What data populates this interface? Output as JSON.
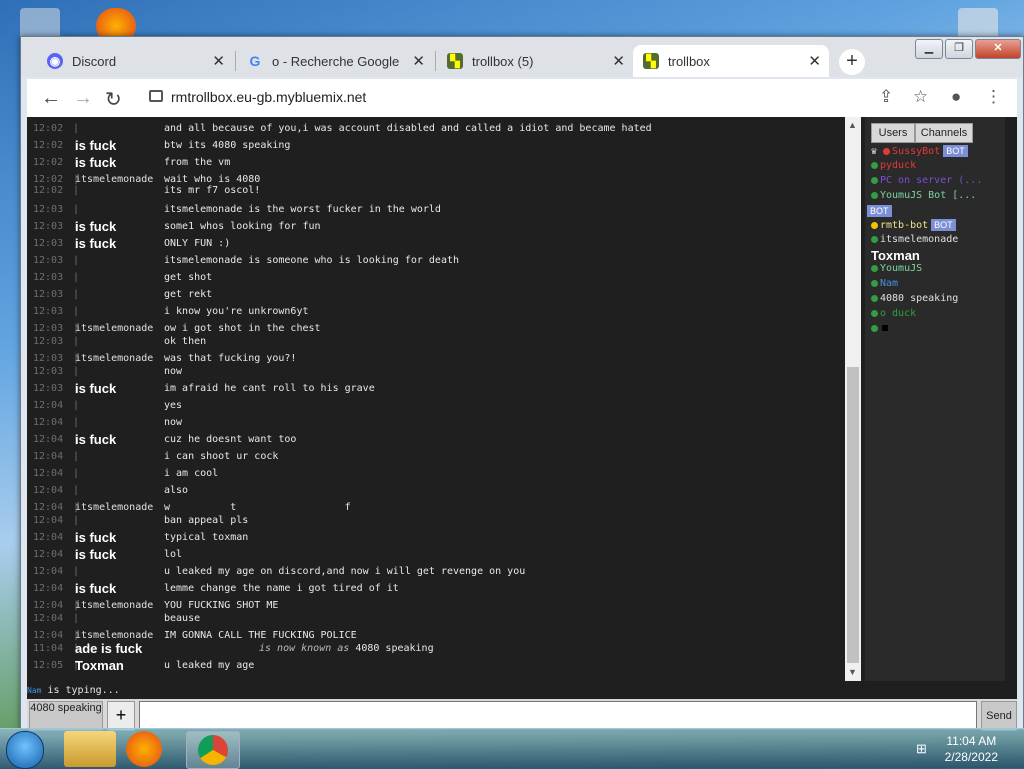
{
  "browser": {
    "tabs": [
      {
        "label": "Discord",
        "icon": "discord-icon"
      },
      {
        "label": "o - Recherche Google",
        "icon": "google-icon"
      },
      {
        "label": "trollbox (5)",
        "icon": "trollbox-icon"
      },
      {
        "label": "trollbox",
        "icon": "trollbox-icon"
      }
    ],
    "url": "rmtrollbox.eu-gb.mybluemix.net"
  },
  "messages": [
    {
      "time": "12:02",
      "user": "",
      "bold": false,
      "text": "and all because of you,i was account disabled and called a idiot and became hated"
    },
    {
      "time": "12:02",
      "user": "is fuck",
      "bold": true,
      "text": "btw its 4080 speaking"
    },
    {
      "time": "12:02",
      "user": "is fuck",
      "bold": true,
      "text": "from the vm"
    },
    {
      "time": "12:02",
      "user": "itsmelemonade",
      "bold": false,
      "text": "wait who is 4080"
    },
    {
      "time": "12:02",
      "user": "",
      "bold": false,
      "text": "its mr f7 oscol!"
    },
    {
      "time": "12:03",
      "user": "",
      "bold": false,
      "text": "itsmelemonade is the worst fucker in the world"
    },
    {
      "time": "12:03",
      "user": "is fuck",
      "bold": true,
      "text": "some1 whos looking for fun"
    },
    {
      "time": "12:03",
      "user": "is fuck",
      "bold": true,
      "text": "ONLY FUN :)"
    },
    {
      "time": "12:03",
      "user": "",
      "bold": false,
      "text": "itsmelemonade is someone who is looking for death"
    },
    {
      "time": "12:03",
      "user": "",
      "bold": false,
      "text": "get shot"
    },
    {
      "time": "12:03",
      "user": "",
      "bold": false,
      "text": "get rekt"
    },
    {
      "time": "12:03",
      "user": "",
      "bold": false,
      "text": "i know you're unkrown6yt"
    },
    {
      "time": "12:03",
      "user": "itsmelemonade",
      "bold": false,
      "text": "ow i got shot in the chest"
    },
    {
      "time": "12:03",
      "user": "",
      "bold": false,
      "text": "ok then"
    },
    {
      "time": "12:03",
      "user": "itsmelemonade",
      "bold": false,
      "text": "was that fucking you?!"
    },
    {
      "time": "12:03",
      "user": "",
      "bold": false,
      "text": "now"
    },
    {
      "time": "12:03",
      "user": "is fuck",
      "bold": true,
      "text": "im afraid he cant roll to his grave"
    },
    {
      "time": "12:04",
      "user": "",
      "bold": false,
      "text": "yes"
    },
    {
      "time": "12:04",
      "user": "",
      "bold": false,
      "text": "now"
    },
    {
      "time": "12:04",
      "user": "is fuck",
      "bold": true,
      "text": "cuz he doesnt want too"
    },
    {
      "time": "12:04",
      "user": "",
      "bold": false,
      "text": "i can shoot ur cock"
    },
    {
      "time": "12:04",
      "user": "",
      "bold": false,
      "text": "i am cool"
    },
    {
      "time": "12:04",
      "user": "",
      "bold": false,
      "text": "also"
    },
    {
      "time": "12:04",
      "user": "itsmelemonade",
      "bold": false,
      "text": "w          t                  f"
    },
    {
      "time": "12:04",
      "user": "",
      "bold": false,
      "text": "ban appeal pls"
    },
    {
      "time": "12:04",
      "user": "is fuck",
      "bold": true,
      "text": "typical toxman"
    },
    {
      "time": "12:04",
      "user": "is fuck",
      "bold": true,
      "text": "lol"
    },
    {
      "time": "12:04",
      "user": "",
      "bold": false,
      "text": "u leaked my age on discord,and now i will get revenge on you"
    },
    {
      "time": "12:04",
      "user": "is fuck",
      "bold": true,
      "text": "lemme change the name i got tired of it"
    },
    {
      "time": "12:04",
      "user": "itsmelemonade",
      "bold": false,
      "text": "YOU FUCKING SHOT ME"
    },
    {
      "time": "12:04",
      "user": "",
      "bold": false,
      "text": "beause"
    },
    {
      "time": "12:04",
      "user": "itsmelemonade",
      "bold": false,
      "text": "IM GONNA CALL THE FUCKING POLICE"
    },
    {
      "time": "11:04",
      "user": "ade is fuck",
      "bold": true,
      "text": "",
      "em": "is now known as",
      "tail": " 4080 speaking"
    },
    {
      "time": "12:05",
      "user": "Toxman",
      "bold": true,
      "text": "u leaked my age"
    }
  ],
  "sidebar": {
    "tab_users": "Users",
    "tab_channels": "Channels",
    "bot_label": "BOT",
    "users": [
      {
        "name": "SussyBot",
        "color": "#e53935",
        "dot": "#e53935",
        "bot": true,
        "prefix": "♛"
      },
      {
        "name": "pyduck",
        "color": "#e53935",
        "dot": "#2ea043",
        "bot": false
      },
      {
        "name": "PC on server (...",
        "color": "#7b4fd6",
        "dot": "#2ea043",
        "bot": false
      },
      {
        "name": "YoumuJS Bot [...",
        "color": "#7fd3a0",
        "dot": "#2ea043",
        "bot": true
      },
      {
        "name": "rmtb-bot",
        "color": "#f0e68c",
        "dot": "#f2c400",
        "bot": true
      },
      {
        "name": "itsmelemonade",
        "color": "#e0e0e0",
        "dot": "#2ea043",
        "bot": false
      },
      {
        "name": "Toxman",
        "color": "#ffffff",
        "dot": "",
        "bot": false,
        "bold": true
      },
      {
        "name": "YoumuJS",
        "color": "#7fd3a0",
        "dot": "#2ea043",
        "bot": false
      },
      {
        "name": "Nam",
        "color": "#4a8fe0",
        "dot": "#2ea043",
        "bot": false
      },
      {
        "name": "4080 speaking",
        "color": "#e0e0e0",
        "dot": "#2ea043",
        "bot": false
      },
      {
        "name": "o duck",
        "color": "#2ea043",
        "dot": "#2ea043",
        "bot": false
      },
      {
        "name": "",
        "color": "#e0e0e0",
        "dot": "#2ea043",
        "bot": false,
        "square": true
      }
    ]
  },
  "typing": {
    "name": "Nam",
    "text": "is typing..."
  },
  "composer": {
    "name_button": "4080 speaking",
    "plus": "+",
    "send": "Send"
  },
  "taskbar": {
    "time": "11:04 AM",
    "date": "2/28/2022"
  }
}
